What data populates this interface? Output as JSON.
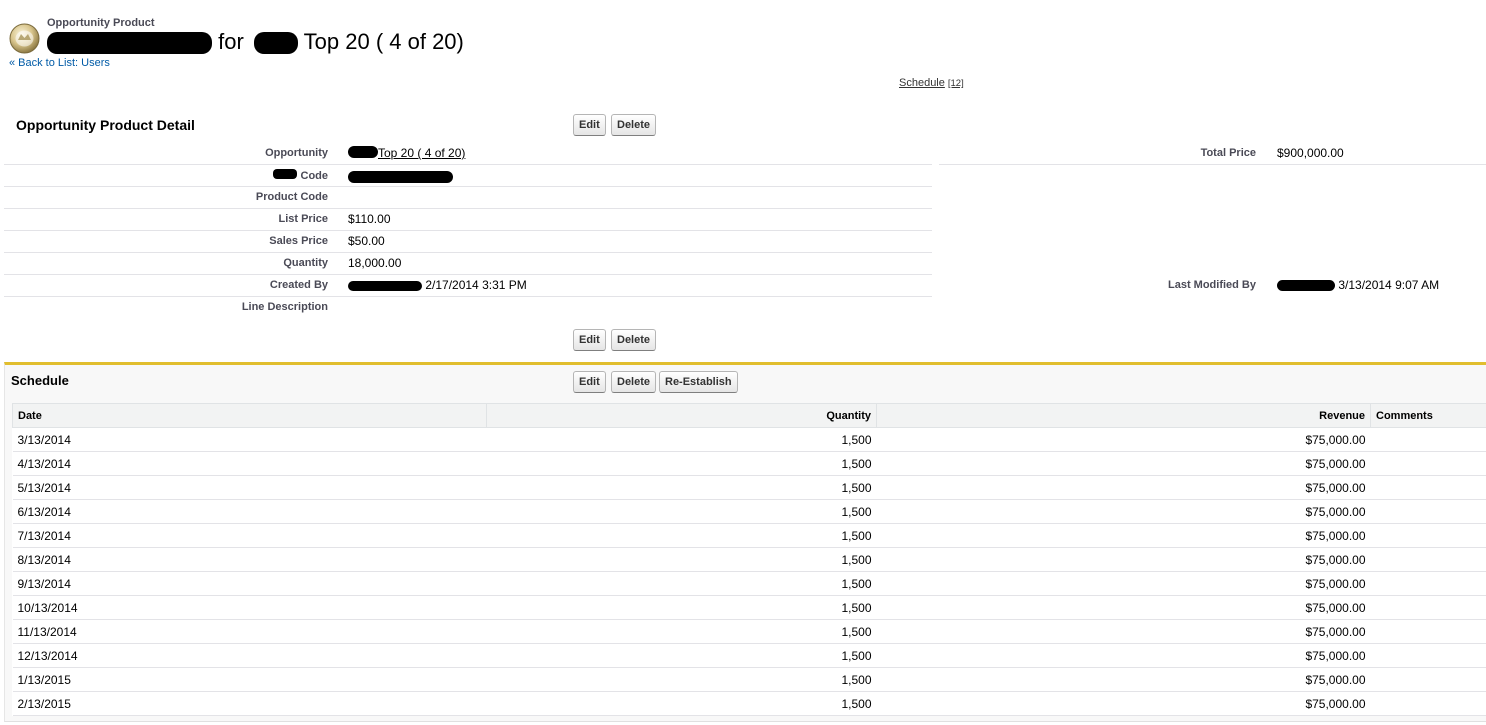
{
  "header": {
    "object_type": "Opportunity Product",
    "title_mid": "for",
    "title_end": "Top 20 ( 4 of 20)",
    "back_link": "« Back to List: Users",
    "schedule_link": "Schedule",
    "schedule_count": "[12]"
  },
  "detail": {
    "heading": "Opportunity Product Detail",
    "edit_label": "Edit",
    "delete_label": "Delete",
    "fields": {
      "opportunity_label": "Opportunity",
      "opportunity_value": "Top 20 ( 4 of 20)",
      "code_label": "Code",
      "product_code_label": "Product Code",
      "product_code_value": "",
      "list_price_label": "List Price",
      "list_price_value": "$110.00",
      "sales_price_label": "Sales Price",
      "sales_price_value": "$50.00",
      "quantity_label": "Quantity",
      "quantity_value": "18,000.00",
      "created_by_label": "Created By",
      "created_by_value": "2/17/2014 3:31 PM",
      "line_description_label": "Line Description",
      "line_description_value": "",
      "total_price_label": "Total Price",
      "total_price_value": "$900,000.00",
      "last_modified_label": "Last Modified By",
      "last_modified_value": "3/13/2014 9:07 AM"
    }
  },
  "schedule": {
    "heading": "Schedule",
    "edit_label": "Edit",
    "delete_label": "Delete",
    "reestablish_label": "Re-Establish",
    "columns": {
      "date": "Date",
      "quantity": "Quantity",
      "revenue": "Revenue",
      "comments": "Comments"
    },
    "rows": [
      {
        "date": "3/13/2014",
        "quantity": "1,500",
        "revenue": "$75,000.00",
        "comments": ""
      },
      {
        "date": "4/13/2014",
        "quantity": "1,500",
        "revenue": "$75,000.00",
        "comments": ""
      },
      {
        "date": "5/13/2014",
        "quantity": "1,500",
        "revenue": "$75,000.00",
        "comments": ""
      },
      {
        "date": "6/13/2014",
        "quantity": "1,500",
        "revenue": "$75,000.00",
        "comments": ""
      },
      {
        "date": "7/13/2014",
        "quantity": "1,500",
        "revenue": "$75,000.00",
        "comments": ""
      },
      {
        "date": "8/13/2014",
        "quantity": "1,500",
        "revenue": "$75,000.00",
        "comments": ""
      },
      {
        "date": "9/13/2014",
        "quantity": "1,500",
        "revenue": "$75,000.00",
        "comments": ""
      },
      {
        "date": "10/13/2014",
        "quantity": "1,500",
        "revenue": "$75,000.00",
        "comments": ""
      },
      {
        "date": "11/13/2014",
        "quantity": "1,500",
        "revenue": "$75,000.00",
        "comments": ""
      },
      {
        "date": "12/13/2014",
        "quantity": "1,500",
        "revenue": "$75,000.00",
        "comments": ""
      },
      {
        "date": "1/13/2015",
        "quantity": "1,500",
        "revenue": "$75,000.00",
        "comments": ""
      },
      {
        "date": "2/13/2015",
        "quantity": "1,500",
        "revenue": "$75,000.00",
        "comments": ""
      }
    ]
  },
  "colors": {
    "link_blue": "#015ba7",
    "schedule_accent": "#e1be2e",
    "label_gray": "#4a4a56"
  },
  "icons": {
    "header_icon": "opportunity-product-coin-icon"
  }
}
